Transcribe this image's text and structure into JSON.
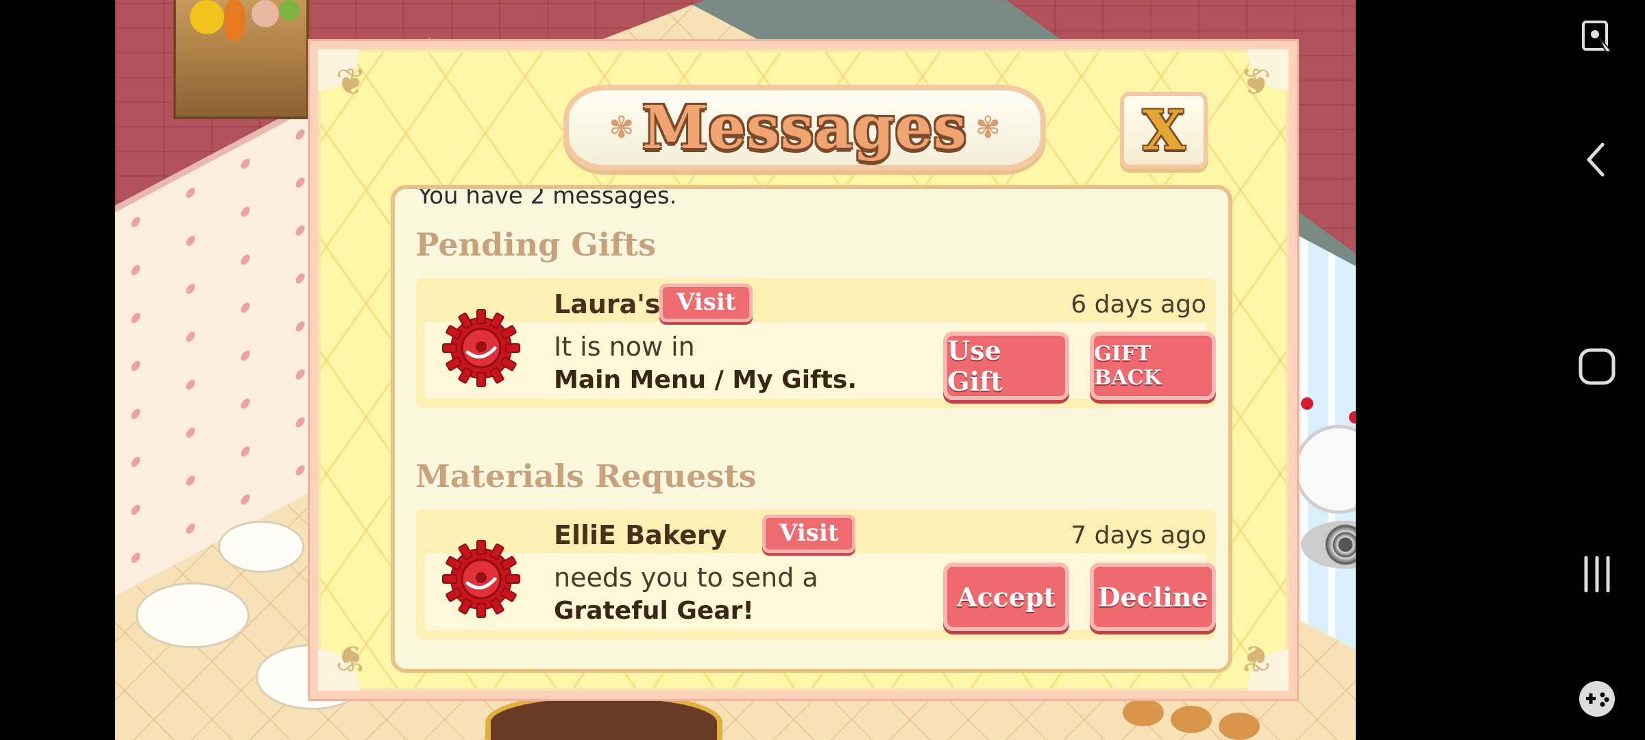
{
  "dialog": {
    "title": "Messages",
    "close_label": "X",
    "message_count_text": "You have 2 messages.",
    "sections": [
      {
        "title": "Pending Gifts",
        "message": {
          "sender": "Laura's",
          "visit_label": "Visit",
          "time_ago": "6 days ago",
          "line1": "It is now in",
          "line2": "Main Menu / My Gifts.",
          "primary_action": "Use Gift",
          "secondary_action": "GIFT BACK",
          "icon": "red-gear-icon"
        }
      },
      {
        "title": "Materials Requests",
        "message": {
          "sender": "ElliE Bakery",
          "visit_label": "Visit",
          "time_ago": "7 days ago",
          "line1": "needs you to send a",
          "line2": "Grateful Gear!",
          "primary_action": "Accept",
          "secondary_action": "Decline",
          "icon": "red-gear-icon"
        }
      }
    ]
  },
  "system_nav": {
    "icons": [
      "screen-lock-icon",
      "back-icon",
      "home-icon",
      "recent-apps-icon",
      "game-tools-icon"
    ]
  },
  "colors": {
    "dialog_background": "#fff6a8",
    "button_red": "#ef6a6e",
    "title_orange": "#f0a471",
    "text_brown": "#4a2f1a"
  }
}
